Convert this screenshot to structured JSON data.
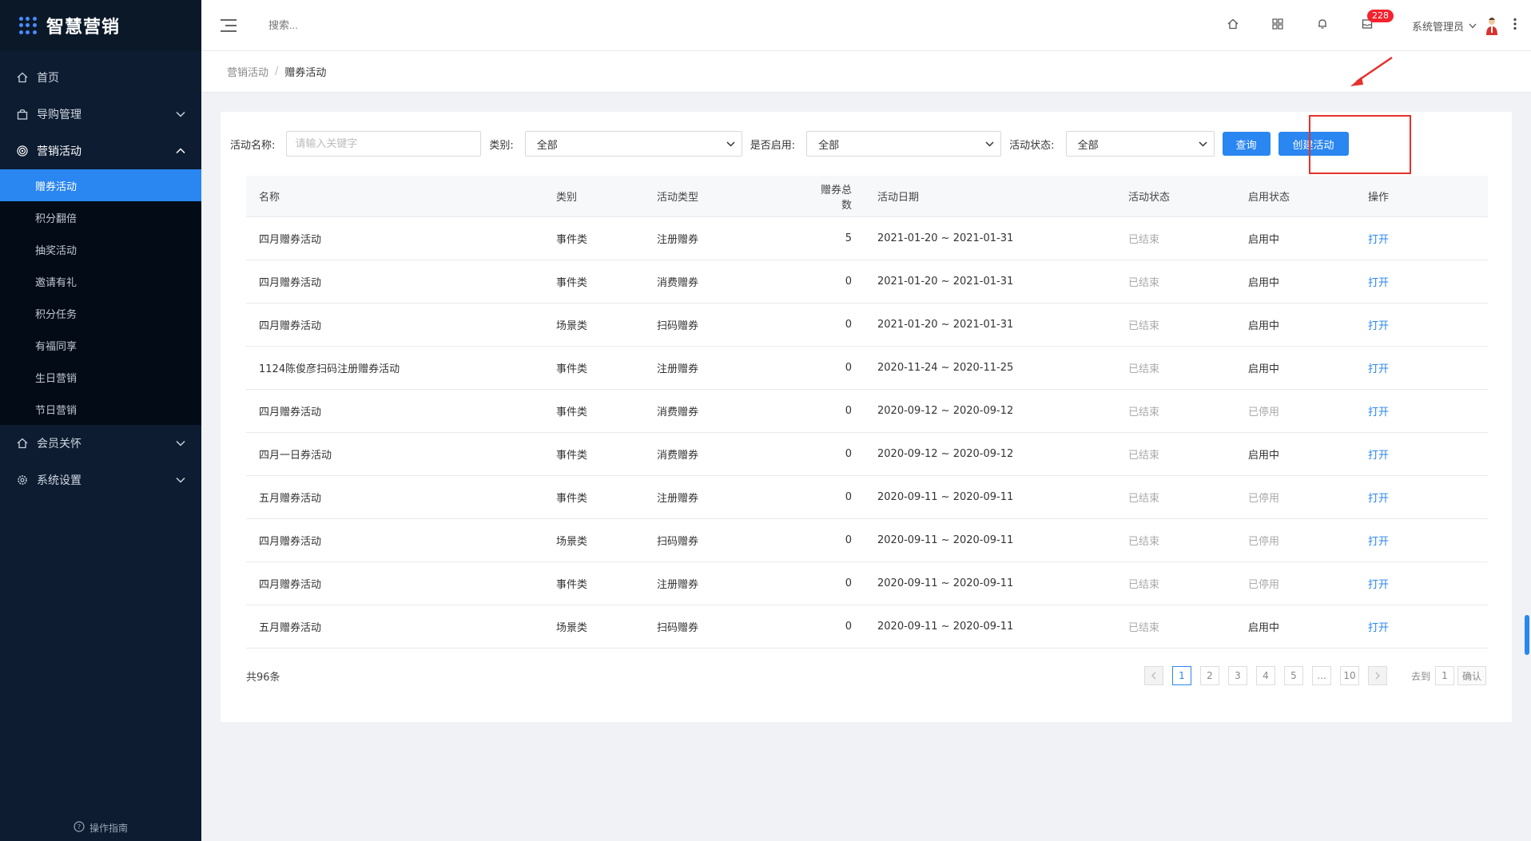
{
  "app": {
    "name": "智慧营销"
  },
  "sidebar": {
    "menu": [
      {
        "label": "首页",
        "icon": "home-icon"
      },
      {
        "label": "导购管理",
        "icon": "bag-icon"
      },
      {
        "label": "营销活动",
        "icon": "target-icon"
      }
    ],
    "submenu": [
      "赠券活动",
      "积分翻倍",
      "抽奖活动",
      "邀请有礼",
      "积分任务",
      "有福同享",
      "生日营销",
      "节日营销"
    ],
    "menu_after": [
      {
        "label": "会员关怀",
        "icon": "home-icon"
      },
      {
        "label": "系统设置",
        "icon": "gear-icon"
      }
    ],
    "footer": "操作指南"
  },
  "header": {
    "search_placeholder": "搜索...",
    "badge_count": "228",
    "user_name": "系统管理员"
  },
  "breadcrumb": {
    "parent": "营销活动",
    "separator": "/",
    "current": "赠券活动"
  },
  "filters": {
    "name_label": "活动名称:",
    "name_placeholder": "请输入关键字",
    "category_label": "类别:",
    "category_value": "全部",
    "enabled_label": "是否启用:",
    "enabled_value": "全部",
    "status_label": "活动状态:",
    "status_value": "全部",
    "query_button": "查询",
    "create_button": "创建活动"
  },
  "table": {
    "headers": [
      "名称",
      "类别",
      "活动类型",
      "赠券总数",
      "活动日期",
      "活动状态",
      "启用状态",
      "操作"
    ],
    "rows": [
      [
        "四月赠券活动",
        "事件类",
        "注册赠券",
        "5",
        "2021-01-20 ~ 2021-01-31",
        "已结束",
        "启用中",
        "打开"
      ],
      [
        "四月赠券活动",
        "事件类",
        "消费赠券",
        "0",
        "2021-01-20 ~ 2021-01-31",
        "已结束",
        "启用中",
        "打开"
      ],
      [
        "四月赠券活动",
        "场景类",
        "扫码赠券",
        "0",
        "2021-01-20 ~ 2021-01-31",
        "已结束",
        "启用中",
        "打开"
      ],
      [
        "1124陈俊彦扫码注册赠券活动",
        "事件类",
        "注册赠券",
        "0",
        "2020-11-24 ~ 2020-11-25",
        "已结束",
        "启用中",
        "打开"
      ],
      [
        "四月赠券活动",
        "事件类",
        "消费赠券",
        "0",
        "2020-09-12 ~ 2020-09-12",
        "已结束",
        "已停用",
        "打开"
      ],
      [
        "四月一日券活动",
        "事件类",
        "消费赠券",
        "0",
        "2020-09-12 ~ 2020-09-12",
        "已结束",
        "启用中",
        "打开"
      ],
      [
        "五月赠券活动",
        "事件类",
        "注册赠券",
        "0",
        "2020-09-11 ~ 2020-09-11",
        "已结束",
        "已停用",
        "打开"
      ],
      [
        "四月赠券活动",
        "场景类",
        "扫码赠券",
        "0",
        "2020-09-11 ~ 2020-09-11",
        "已结束",
        "已停用",
        "打开"
      ],
      [
        "四月赠券活动",
        "事件类",
        "注册赠券",
        "0",
        "2020-09-11 ~ 2020-09-11",
        "已结束",
        "已停用",
        "打开"
      ],
      [
        "五月赠券活动",
        "场景类",
        "扫码赠券",
        "0",
        "2020-09-11 ~ 2020-09-11",
        "已结束",
        "启用中",
        "打开"
      ]
    ]
  },
  "pagination": {
    "total": "共96条",
    "pages": [
      "1",
      "2",
      "3",
      "4",
      "5",
      "...",
      "10"
    ],
    "current": "1",
    "goto_label": "去到",
    "goto_value": "1",
    "confirm": "确认"
  },
  "colors": {
    "sidebar_bg": "#0d1c31",
    "accent": "#2a86f0",
    "badge": "#f5222d",
    "highlight": "#e5322d"
  }
}
